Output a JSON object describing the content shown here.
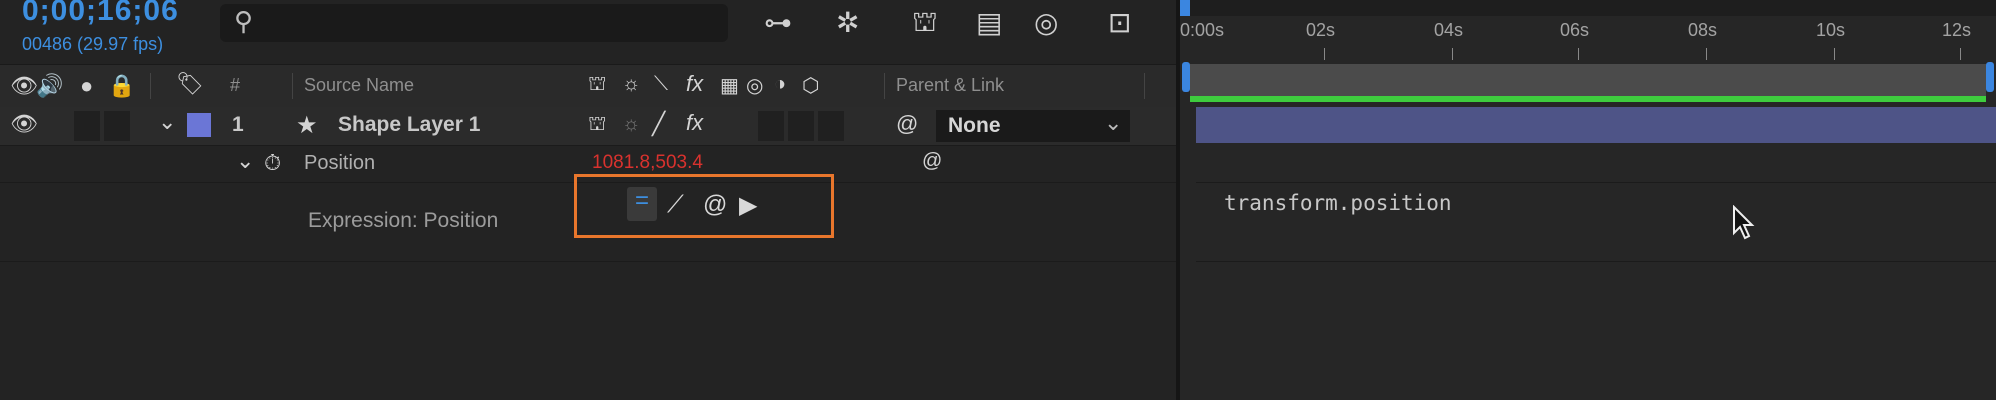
{
  "header": {
    "timecode": "0;00;16;06",
    "fps": "00486 (29.97 fps)",
    "search_placeholder": ""
  },
  "columns": {
    "number": "#",
    "source_name": "Source Name",
    "parent_link": "Parent & Link"
  },
  "layer": {
    "number": "1",
    "name": "Shape Layer 1",
    "label_color": "#6b76d6",
    "parent": "None"
  },
  "property": {
    "name": "Position",
    "value": "1081.8,503.4",
    "value_color": "#d9322e"
  },
  "expression": {
    "label": "Expression: Position",
    "code": "transform.position"
  },
  "timeline": {
    "ticks": [
      "0:00s",
      "02s",
      "04s",
      "06s",
      "08s",
      "10s",
      "12s"
    ],
    "work_area_color": "#3ecc3e"
  },
  "colors": {
    "accent": "#3d8fe0",
    "highlight_box": "#e8762c"
  }
}
